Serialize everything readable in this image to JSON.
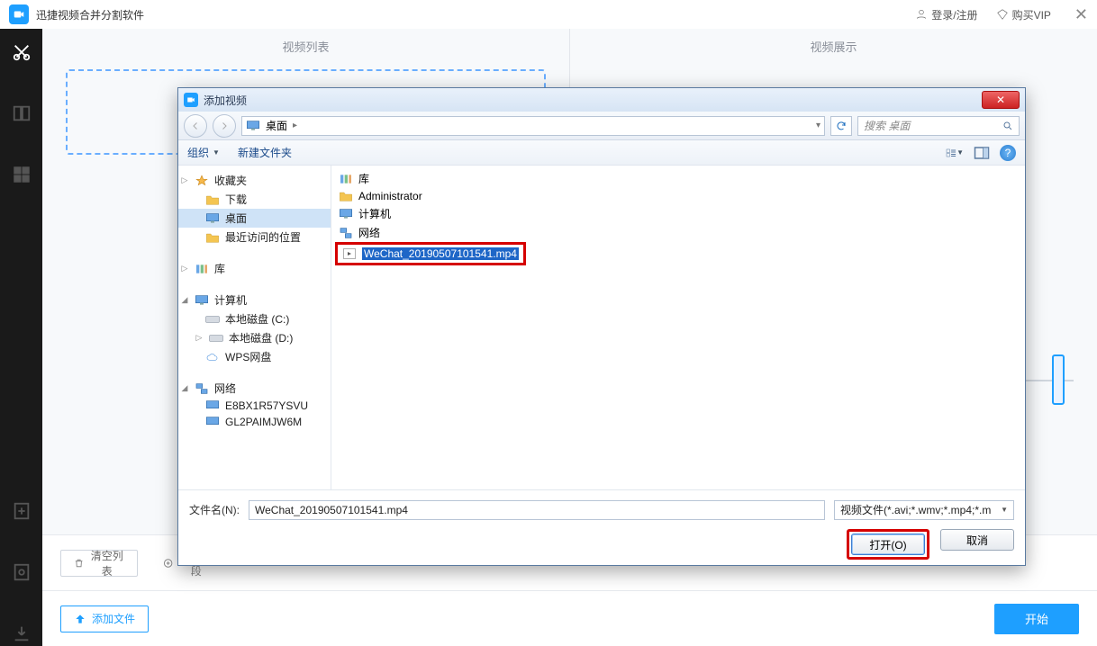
{
  "app": {
    "title": "迅捷视频合并分割软件",
    "login": "登录/注册",
    "vip": "购买VIP"
  },
  "panels": {
    "left_title": "视频列表",
    "right_title": "视频展示"
  },
  "bottom": {
    "clear": "清空列表",
    "segment": "添加分段",
    "add_file": "添加文件",
    "start": "开始"
  },
  "player": {
    "time": "--:--:-- / --:--:--"
  },
  "dialog": {
    "title": "添加视频",
    "breadcrumb": "桌面",
    "breadcrumb_marker": "▸",
    "search_placeholder": "搜索 桌面",
    "organize": "组织",
    "new_folder": "新建文件夹",
    "help_char": "?",
    "tree": {
      "favorites": "收藏夹",
      "downloads": "下载",
      "desktop": "桌面",
      "recent": "最近访问的位置",
      "libraries": "库",
      "computer": "计算机",
      "drive_c": "本地磁盘 (C:)",
      "drive_d": "本地磁盘 (D:)",
      "wps": "WPS网盘",
      "network": "网络",
      "net1": "E8BX1R57YSVU",
      "net2": "GL2PAIMJW6M"
    },
    "files": {
      "libraries": "库",
      "admin": "Administrator",
      "computer": "计算机",
      "network": "网络",
      "selected": "WeChat_20190507101541.mp4"
    },
    "filename_label": "文件名(N):",
    "filename_value": "WeChat_20190507101541.mp4",
    "filter": "视频文件(*.avi;*.wmv;*.mp4;*.m",
    "open": "打开(O)",
    "cancel": "取消"
  }
}
